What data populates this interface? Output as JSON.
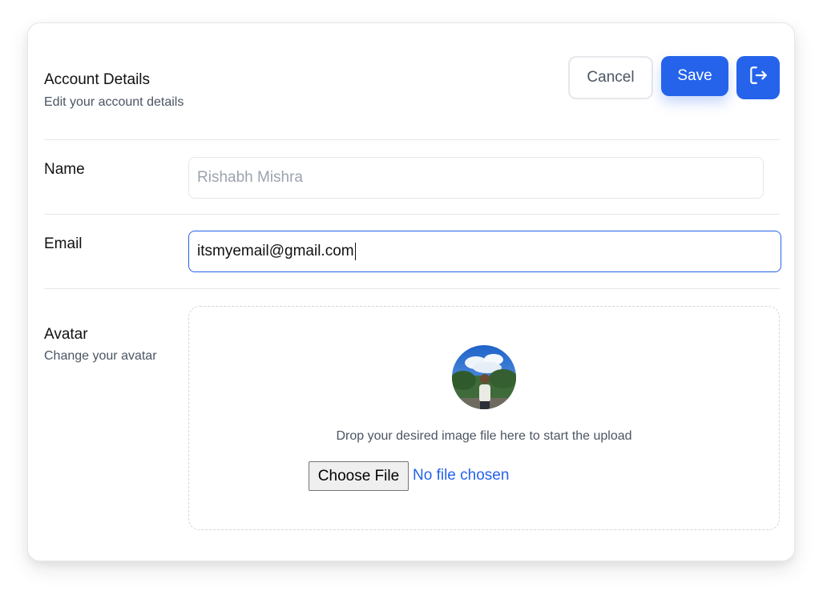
{
  "header": {
    "title": "Account Details",
    "subtitle": "Edit your account details"
  },
  "actions": {
    "cancel_label": "Cancel",
    "save_label": "Save",
    "logout_icon": "logout-icon"
  },
  "fields": {
    "name": {
      "label": "Name",
      "placeholder": "Rishabh Mishra",
      "value": ""
    },
    "email": {
      "label": "Email",
      "value": "itsmyemail@gmail.com"
    },
    "avatar": {
      "label": "Avatar",
      "sublabel": "Change your avatar",
      "drop_text": "Drop your desired image file here to start the upload",
      "choose_file_label": "Choose File",
      "file_status": "No file chosen"
    }
  },
  "colors": {
    "accent": "#2563eb",
    "border": "#e5e7eb",
    "muted_text": "#4b5563",
    "placeholder_text": "#9ca3af"
  }
}
